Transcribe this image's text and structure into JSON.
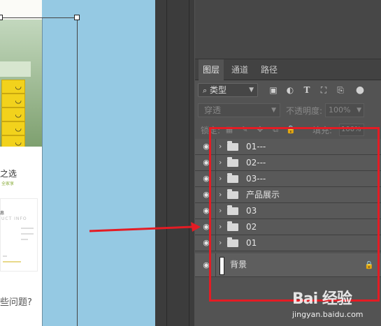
{
  "document": {
    "heading": "之选",
    "sub": "全家享",
    "card_title": "息",
    "card_en": "UCT INFO",
    "question": "些问题?",
    "face_glyph": "◡"
  },
  "layers_panel": {
    "tabs": [
      {
        "label": "图层",
        "active": true
      },
      {
        "label": "通道",
        "active": false
      },
      {
        "label": "路径",
        "active": false
      }
    ],
    "filter": {
      "label": "类型",
      "search_icon": "search-icon"
    },
    "filter_icons": [
      "image-filter-icon",
      "adjustment-filter-icon",
      "text-filter-icon",
      "shape-filter-icon",
      "smart-object-filter-icon",
      "filter-toggle-icon"
    ],
    "blend_mode": "穿透",
    "opacity_label": "不透明度:",
    "opacity_value": "100%",
    "lock_label": "锁定:",
    "fill_label": "填充:",
    "fill_value": "100%",
    "layers": [
      {
        "name": "01---",
        "type": "group"
      },
      {
        "name": "02---",
        "type": "group"
      },
      {
        "name": "03---",
        "type": "group"
      },
      {
        "name": "产品展示",
        "type": "group"
      },
      {
        "name": "03",
        "type": "group"
      },
      {
        "name": "02",
        "type": "group"
      },
      {
        "name": "01",
        "type": "group"
      },
      {
        "name": "背景",
        "type": "background",
        "locked": true
      }
    ]
  },
  "watermark": {
    "logo": "Bai 经验",
    "url": "jingyan.baidu.com"
  },
  "annotation_color": "#e41c24"
}
